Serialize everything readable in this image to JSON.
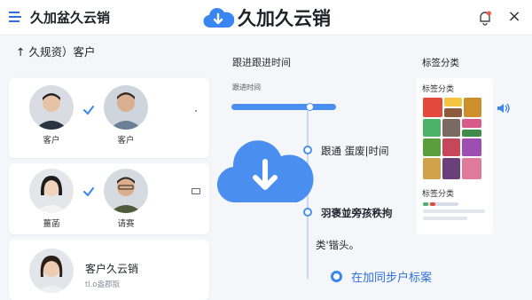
{
  "header": {
    "app_title": "久加盆久云销",
    "brand_name": "久加久云销",
    "menu_icon": "menu-icon",
    "bell_icon": "bell-icon",
    "close_icon": "close-icon",
    "close_glyph": "×"
  },
  "left": {
    "section_title": "↑ 久规资）客户",
    "row1": {
      "a_name": "客户",
      "b_name": "客户",
      "dot": "·"
    },
    "row2": {
      "a_name": "薑菡",
      "b_name": "请赛"
    },
    "row3": {
      "name": "客户久云销",
      "sub": "tl.o盎郡翫"
    }
  },
  "middle": {
    "title": "跟进跟进时间",
    "sub": "跟进时间",
    "progress": 0.75,
    "timeline": [
      {
        "label": "跟通 蛋废|时间"
      },
      {
        "label": "羽褒並旁孩秩拘"
      },
      {
        "label": "类'锴头。"
      }
    ],
    "action": "在加同步户标案"
  },
  "right": {
    "title": "标签分类",
    "sub1": "标签分类",
    "sub2": "标签分类",
    "speaker_icon": "speaker-icon"
  },
  "colors": {
    "accent": "#2f6fe0",
    "cloud": "#4a8ff0",
    "background": "#f4f6f9"
  }
}
